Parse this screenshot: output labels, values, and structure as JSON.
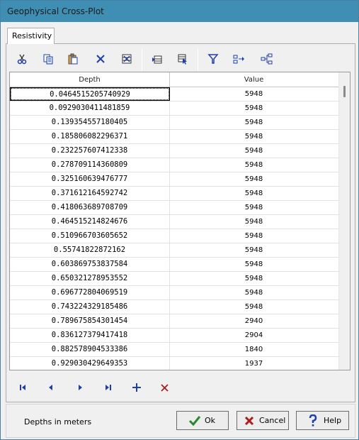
{
  "window": {
    "title": "Geophysical Cross-Plot"
  },
  "tabs": [
    {
      "label": "Resistivity"
    }
  ],
  "toolbar": {
    "buttons": [
      "cut-icon",
      "copy-icon",
      "paste-icon",
      "delete-icon",
      "delete-column-icon",
      "insert-row-icon",
      "select-icon",
      "filter-icon",
      "expand-icon",
      "tree-icon"
    ]
  },
  "grid": {
    "columns": [
      "Depth",
      "Value"
    ],
    "rows": [
      [
        "0.0464515205740929",
        "5948"
      ],
      [
        "0.0929030411481859",
        "5948"
      ],
      [
        "0.139354557180405",
        "5948"
      ],
      [
        "0.185806082296371",
        "5948"
      ],
      [
        "0.232257607412338",
        "5948"
      ],
      [
        "0.278709114360809",
        "5948"
      ],
      [
        "0.325160639476777",
        "5948"
      ],
      [
        "0.371612164592742",
        "5948"
      ],
      [
        "0.418063689708709",
        "5948"
      ],
      [
        "0.464515214824676",
        "5948"
      ],
      [
        "0.510966703605652",
        "5948"
      ],
      [
        "0.55741822872162",
        "5948"
      ],
      [
        "0.603869753837584",
        "5948"
      ],
      [
        "0.650321278953552",
        "5948"
      ],
      [
        "0.696772804069519",
        "5948"
      ],
      [
        "0.743224329185486",
        "5948"
      ],
      [
        "0.789675854301454",
        "2940"
      ],
      [
        "0.836127379417418",
        "2904"
      ],
      [
        "0.882578904533386",
        "1840"
      ],
      [
        "0.929030429649353",
        "1937"
      ]
    ]
  },
  "status": {
    "text": "Depths in meters"
  },
  "buttons": {
    "ok": "Ok",
    "cancel": "Cancel",
    "help": "Help"
  },
  "colors": {
    "titlebar": "#3f8fb5",
    "accent_blue": "#1f3fa8",
    "delete_red": "#b31b1b",
    "ok_green": "#2a8a2a"
  }
}
